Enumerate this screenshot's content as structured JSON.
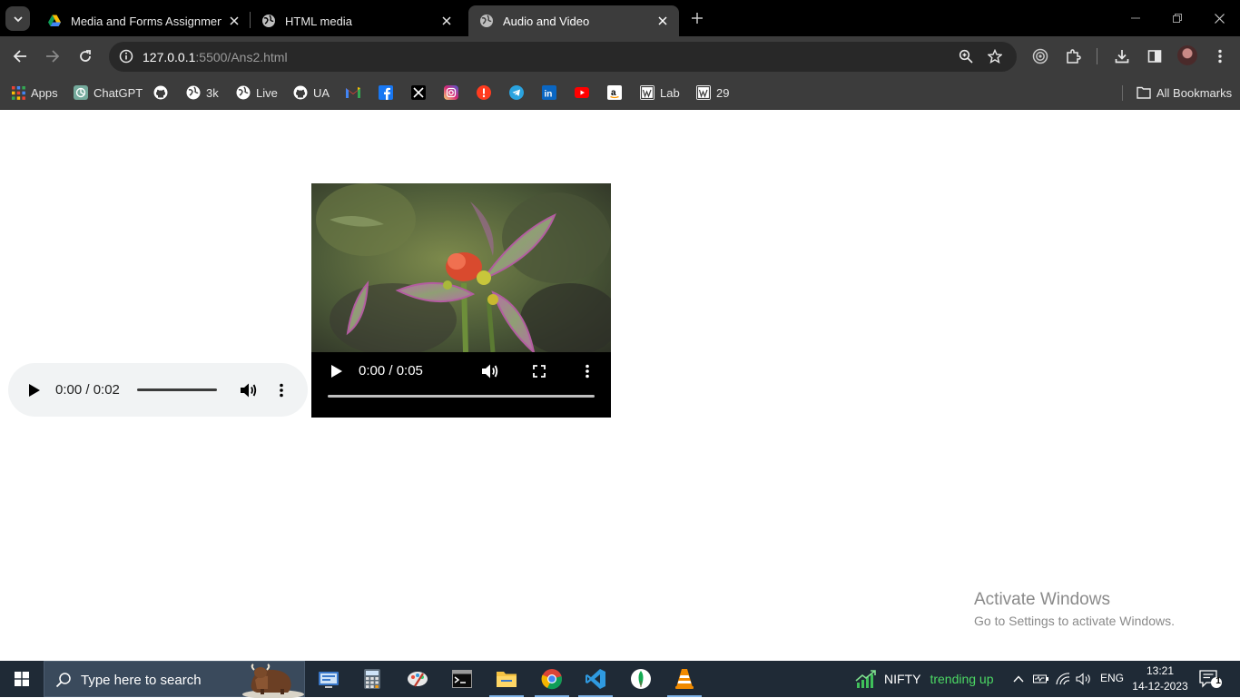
{
  "browser": {
    "tabs": [
      {
        "title": "Media and Forms Assignment.p",
        "icon": "google-drive-icon",
        "active": false
      },
      {
        "title": "HTML media",
        "icon": "globe-icon",
        "active": false
      },
      {
        "title": "Audio and Video",
        "icon": "globe-icon",
        "active": true
      }
    ],
    "url": {
      "host": "127.0.0.1",
      "rest": ":5500/Ans2.html"
    },
    "bookmarks": [
      {
        "label": "Apps",
        "icon": "apps-grid-icon"
      },
      {
        "label": "ChatGPT",
        "icon": "chatgpt-icon"
      },
      {
        "label": "",
        "icon": "github-icon"
      },
      {
        "label": "3k",
        "icon": "globe-icon"
      },
      {
        "label": "Live",
        "icon": "globe-icon"
      },
      {
        "label": "UA",
        "icon": "github-icon"
      },
      {
        "label": "",
        "icon": "gmail-icon"
      },
      {
        "label": "",
        "icon": "facebook-icon"
      },
      {
        "label": "",
        "icon": "x-icon"
      },
      {
        "label": "",
        "icon": "instagram-icon"
      },
      {
        "label": "",
        "icon": "alert-icon"
      },
      {
        "label": "",
        "icon": "telegram-icon"
      },
      {
        "label": "",
        "icon": "linkedin-icon"
      },
      {
        "label": "",
        "icon": "youtube-icon"
      },
      {
        "label": "",
        "icon": "amazon-icon"
      },
      {
        "label": "Lab",
        "icon": "wordpress-icon"
      },
      {
        "label": "29",
        "icon": "wordpress-icon"
      }
    ],
    "all_bookmarks_label": "All Bookmarks"
  },
  "page": {
    "audio": {
      "time": "0:00 / 0:02"
    },
    "video": {
      "time": "0:00 / 0:05"
    },
    "watermark": {
      "line1": "Activate Windows",
      "line2": "Go to Settings to activate Windows."
    }
  },
  "taskbar": {
    "search_placeholder": "Type here to search",
    "apps": [
      "network-app-icon",
      "calculator-icon",
      "paint-icon",
      "terminal-icon",
      "file-explorer-icon",
      "chrome-icon",
      "vscode-icon",
      "mongodb-icon",
      "vlc-icon"
    ],
    "ticker": {
      "name": "NIFTY",
      "status": "trending up"
    },
    "language": "ENG",
    "time": "13:21",
    "date": "14-12-2023",
    "notification_count": "1"
  }
}
